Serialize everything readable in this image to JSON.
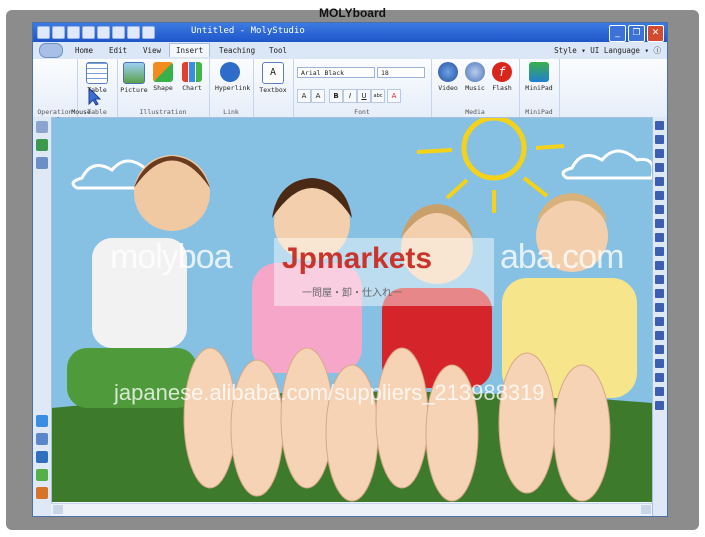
{
  "board": {
    "brand": "MOLYboard"
  },
  "window": {
    "title": "Untitled - MolyStudio"
  },
  "tabs": [
    "Home",
    "Edit",
    "View",
    "Insert",
    "Teaching",
    "Tool"
  ],
  "right_options": "Style ▾ UI Language ▾ ⓘ",
  "ribbon": {
    "operation": {
      "label": "Operation",
      "tool": "Mouse\nMode"
    },
    "table": {
      "label": "Table",
      "tool": "Table"
    },
    "illustration": {
      "label": "Illustration",
      "tools": [
        "Picture",
        "Shape",
        "Chart"
      ]
    },
    "link": {
      "label": "Link",
      "tool": "Hyperlink"
    },
    "textbox": "Textbox",
    "font": {
      "label": "Font",
      "family": "Arial Black",
      "size": "18"
    },
    "media": {
      "label": "Media",
      "tools": [
        "Video",
        "Music",
        "Flash"
      ]
    },
    "minipad": {
      "label": "MiniPad",
      "tool": "MiniPad"
    }
  },
  "watermarks": {
    "brand_left": "molyboa",
    "brand_right": "aba.com",
    "jp_brand": "Jpmarkets",
    "jp_sub": "一問屋・卸・仕入れ一",
    "url": "japanese.alibaba.com/suppliers_213988319"
  },
  "colors": {
    "titlebar": "#1e56c8",
    "sky": "#7fb9de",
    "grass": "#3d7a2c",
    "sun": "#f4d21a"
  }
}
